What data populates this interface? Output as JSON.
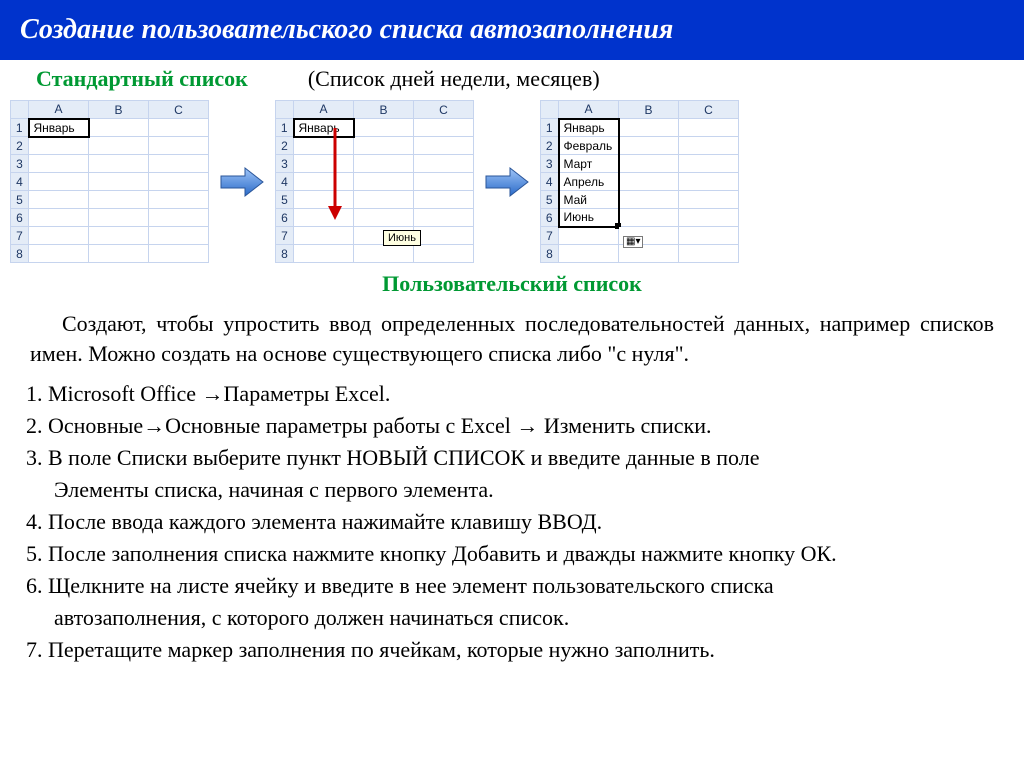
{
  "title": "Создание пользовательского списка автозаполнения",
  "subtitle_left": "Стандартный список",
  "subtitle_right": "(Список дней недели, месяцев)",
  "grid1": {
    "cols": [
      "A",
      "B",
      "C"
    ],
    "rows": [
      "1",
      "2",
      "3",
      "4",
      "5",
      "6",
      "7",
      "8"
    ],
    "A1": "Январь"
  },
  "grid2": {
    "cols": [
      "A",
      "B",
      "C"
    ],
    "rows": [
      "1",
      "2",
      "3",
      "4",
      "5",
      "6",
      "7",
      "8"
    ],
    "A1": "Январь",
    "tooltip": "Июнь"
  },
  "grid3": {
    "cols": [
      "A",
      "B",
      "C"
    ],
    "rows": [
      "1",
      "2",
      "3",
      "4",
      "5",
      "6",
      "7",
      "8"
    ],
    "A": [
      "Январь",
      "Февраль",
      "Март",
      "Апрель",
      "Май",
      "Июнь",
      "",
      ""
    ]
  },
  "custom_title": "Пользовательский  список",
  "body": "Создают, чтобы упростить ввод определенных последовательностей данных, например списков имен.  Можно создать на основе существующего списка либо \"с нуля\".",
  "steps": {
    "s1": "1. Microsoft Office →Параметры Excel.",
    "s2": "2. Основные→Основные параметры работы с Excel → Изменить списки.",
    "s3a": "3. В поле Списки выберите пункт НОВЫЙ СПИСОК и введите данные в поле",
    "s3b": "Элементы списка, начиная с первого элемента.",
    "s4": "4. После ввода каждого элемента нажимайте клавишу ВВОД.",
    "s5": "5. После заполнения списка нажмите кнопку Добавить и дважды нажмите кнопку ОК.",
    "s6a": "6. Щелкните на листе ячейку и введите в нее элемент пользовательского списка",
    "s6b": "автозаполнения, с которого должен начинаться список.",
    "s7": "7. Перетащите маркер заполнения по ячейкам, которые нужно заполнить."
  }
}
